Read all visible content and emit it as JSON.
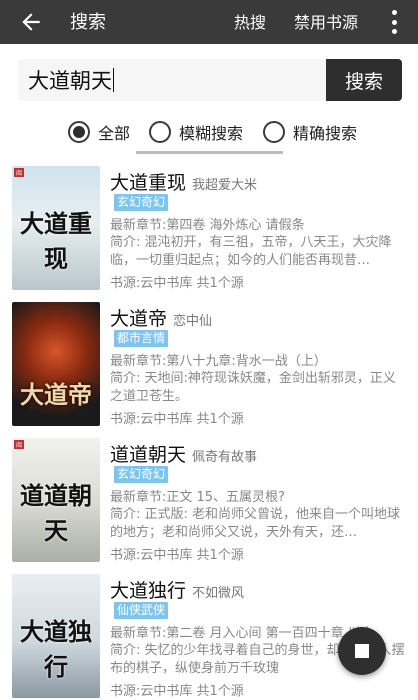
{
  "toolbar": {
    "title": "搜索",
    "hot_label": "热搜",
    "ban_label": "禁用书源",
    "back_icon": "arrow-left-icon",
    "more_icon": "more-vertical-icon"
  },
  "search": {
    "value": "大道朝天",
    "button_label": "搜索"
  },
  "modes": {
    "selected": "全部",
    "options": [
      "全部",
      "模糊搜索",
      "精确搜索"
    ]
  },
  "books": [
    {
      "title": "大道重现",
      "author": "我超爱大米",
      "tag": "玄幻奇幻",
      "latest": "最新章节:第四卷  海外炼心 请假条",
      "intro": "简介: 混沌初开，有三祖，五帝，八天王，大灾降临，一切重归起点；如今的人们能否再现昔…",
      "source": "书源:云中书库 共1个源",
      "cover_text": "大道重现"
    },
    {
      "title": "大道帝",
      "author": "恋中仙",
      "tag": "都市言情",
      "latest": "最新章节:第八十九章:背水一战（上）",
      "intro": "简介: 天地间:神符现诛妖魔，金剑出斩邪灵，正义之道卫苍生。",
      "source": "书源:云中书库 共1个源",
      "cover_text": "大道帝"
    },
    {
      "title": "道道朝天",
      "author": "佩奇有故事",
      "tag": "玄幻奇幻",
      "latest": "最新章节:正文 15、五属灵根?",
      "intro": "简介: 正式版:  老和尚师父曾说，他来自一个叫地球的地方；老和尚师父又说，天外有天，还…",
      "source": "书源:云中书库 共1个源",
      "cover_text": "道道朝天"
    },
    {
      "title": "大道独行",
      "author": "不如微风",
      "tag": "仙侠武侠",
      "latest": "最新章节:第二卷  月入心间 第一百四十章 以人",
      "intro": "简介: 失忆的少年找寻着自己的身世，却又像被人摆布的棋子，纵使身前万千玫瑰",
      "source": "书源:云中书库 共1个源",
      "cover_text": "大道独行"
    }
  ],
  "fab": {
    "icon": "stop-icon"
  },
  "colors": {
    "toolbar_bg": "#3a3a3a",
    "search_button_bg": "#2e2e2e",
    "tag_bg": "#7fc4ee",
    "fab_bg": "#2f2f2f"
  }
}
